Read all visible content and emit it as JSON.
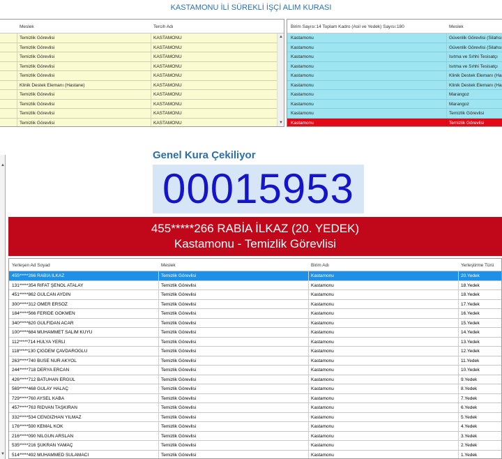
{
  "window": {
    "title": "KASTAMONU İLİ SÜREKLİ İŞÇİ ALIM KURASI"
  },
  "top_left": {
    "columns": [
      "Meslek",
      "Tercih Adı"
    ],
    "rows": [
      [
        "Temizlik Görevlisi",
        "KASTAMONU"
      ],
      [
        "Temizlik Görevlisi",
        "KASTAMONU"
      ],
      [
        "Temizlik Görevlisi",
        "KASTAMONU"
      ],
      [
        "Temizlik Görevlisi",
        "KASTAMONU"
      ],
      [
        "Temizlik Görevlisi",
        "KASTAMONU"
      ],
      [
        "Klinik Destek Elemanı (Hastane)",
        "KASTAMONU"
      ],
      [
        "Temizlik Görevlisi",
        "KASTAMONU"
      ],
      [
        "Temizlik Görevlisi",
        "KASTAMONU"
      ],
      [
        "Temizlik Görevlisi",
        "KASTAMONU"
      ],
      [
        "Temizlik Görevlisi",
        "KASTAMONU"
      ]
    ]
  },
  "top_right": {
    "columns": [
      "Birim Sayısı:14 Toplam Kadro (Asil ve Yedek) Sayısı:180",
      "Meslek"
    ],
    "rows": [
      [
        "Kastamonu",
        "Güvenlik Görevlisi (Silahsız"
      ],
      [
        "Kastamonu",
        "Güvenlik Görevlisi (Silahsız"
      ],
      [
        "Kastamonu",
        "Isıtma ve Sıhhi Tesisatçı"
      ],
      [
        "Kastamonu",
        "Isıtma ve Sıhhi Tesisatçı"
      ],
      [
        "Kastamonu",
        "Klinik Destek Elemanı (Has"
      ],
      [
        "Kastamonu",
        "Klinik Destek Elemanı (Has"
      ],
      [
        "Kastamonu",
        "Marangoz"
      ],
      [
        "Kastamonu",
        "Marangoz"
      ],
      [
        "Kastamonu",
        "Temizlik Görevlisi"
      ],
      [
        "Kastamonu",
        "Temizlik Görevlisi"
      ]
    ],
    "selected_index": 9
  },
  "draw": {
    "label": "Genel Kura Çekiliyor",
    "number": "00015953"
  },
  "result": {
    "line1": "455*****266 RABİA İLKAZ (20. YEDEK)",
    "line2": "Kastamonu - Temizlik Görevlisi"
  },
  "bottom_table": {
    "columns": [
      "Yerleşen Ad Soyad",
      "Meslek",
      "Birim Adı",
      "Yerleştirme Türü"
    ],
    "rows": [
      [
        "455*****266 RABİA İLKAZ",
        "Temizlik Görevlisi",
        "Kastamonu",
        "20.Yedek"
      ],
      [
        "131*****354 RIFAT ŞENOL ATALAY",
        "Temizlik Görevlisi",
        "Kastamonu",
        "18.Yedek"
      ],
      [
        "451*****862 GÜLCAN AYDIN",
        "Temizlik Görevlisi",
        "Kastamonu",
        "18.Yedek"
      ],
      [
        "300*****312 ÖMER ERSÖZ",
        "Temizlik Görevlisi",
        "Kastamonu",
        "17.Yedek"
      ],
      [
        "184*****566 FERİDE GÖKMEN",
        "Temizlik Görevlisi",
        "Kastamonu",
        "16.Yedek"
      ],
      [
        "340*****620 GÜLFİDAN ACAR",
        "Temizlik Görevlisi",
        "Kastamonu",
        "15.Yedek"
      ],
      [
        "100*****684 MUHAMMET SALİM KUYU",
        "Temizlik Görevlisi",
        "Kastamonu",
        "14.Yedek"
      ],
      [
        "112*****714 HÜLYA YERLİ",
        "Temizlik Görevlisi",
        "Kastamonu",
        "13.Yedek"
      ],
      [
        "118*****130 ÇİĞDEM ÇAVDAROĞLU",
        "Temizlik Görevlisi",
        "Kastamonu",
        "12.Yedek"
      ],
      [
        "263*****740 BUSE NUR AKYOL",
        "Temizlik Görevlisi",
        "Kastamonu",
        "11.Yedek"
      ],
      [
        "244*****718 DERYA ERCAN",
        "Temizlik Görevlisi",
        "Kastamonu",
        "10.Yedek"
      ],
      [
        "426*****712 BATUHAN ERGÜL",
        "Temizlik Görevlisi",
        "Kastamonu",
        "9.Yedek"
      ],
      [
        "569*****468 GÜLAY HALAÇ",
        "Temizlik Görevlisi",
        "Kastamonu",
        "8.Yedek"
      ],
      [
        "729*****760 AYSEL KABA",
        "Temizlik Görevlisi",
        "Kastamonu",
        "7.Yedek"
      ],
      [
        "457*****763 RIDVAN TAŞKIRAN",
        "Temizlik Görevlisi",
        "Kastamonu",
        "6.Yedek"
      ],
      [
        "332*****534 CENGİZHAN YILMAZ",
        "Temizlik Görevlisi",
        "Kastamonu",
        "5.Yedek"
      ],
      [
        "176*****590 KEMAL KÖK",
        "Temizlik Görevlisi",
        "Kastamonu",
        "4.Yedek"
      ],
      [
        "216*****090 NİLGÜN ARSLAN",
        "Temizlik Görevlisi",
        "Kastamonu",
        "3.Yedek"
      ],
      [
        "535*****216 ŞÜKRAN YAMAÇ",
        "Temizlik Görevlisi",
        "Kastamonu",
        "2.Yedek"
      ],
      [
        "514*****492 MUHAMMED SULAMACI",
        "Temizlik Görevlisi",
        "Kastamonu",
        "1.Yedek"
      ]
    ],
    "selected_index": 0
  },
  "colors": {
    "title": "#2a6fb0",
    "yellow_rows": "#fbfbd2",
    "cyan_rows": "#9fe5f1",
    "highlight_red": "#c0081a",
    "selected_blue": "#1e90e8",
    "draw_number": "#1414c8"
  }
}
